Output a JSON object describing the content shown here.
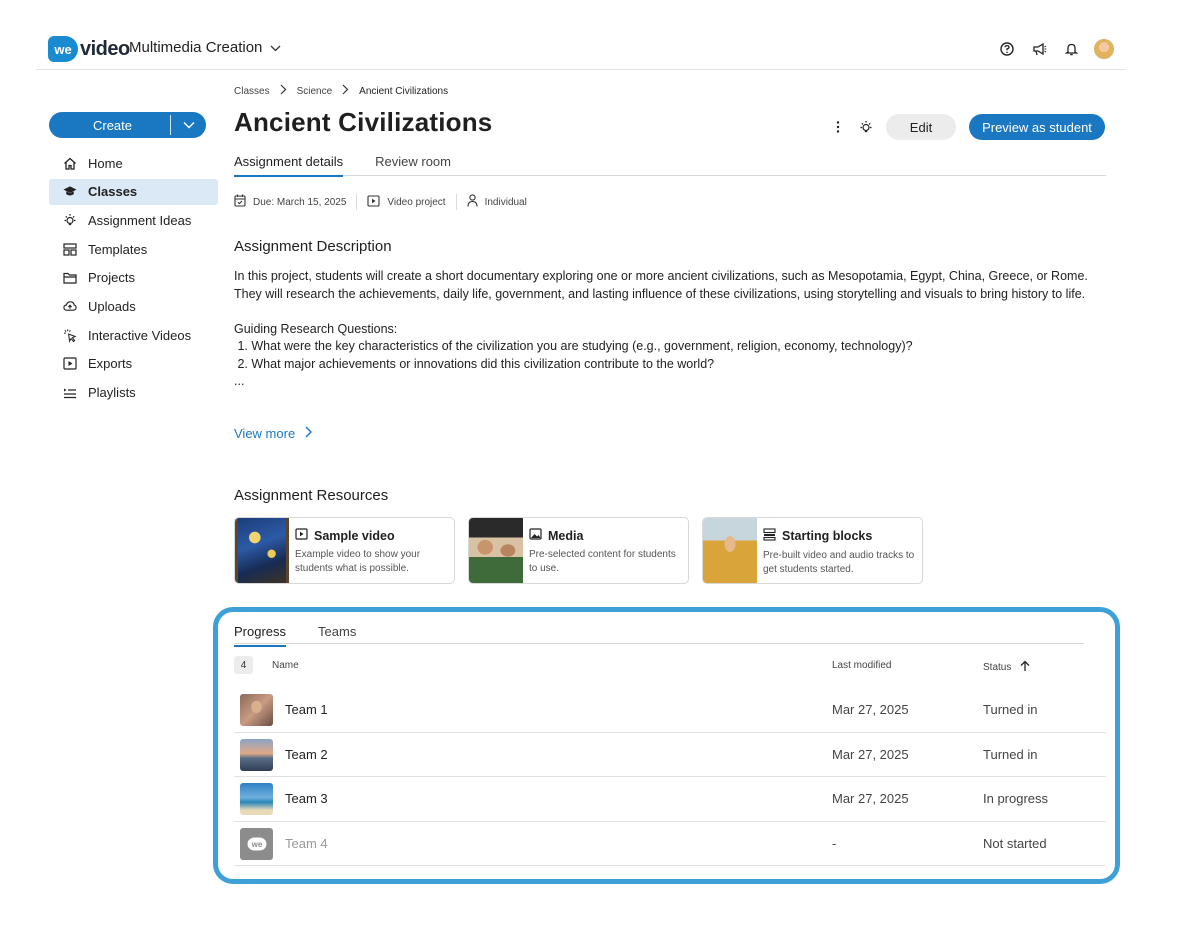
{
  "app": {
    "logo_badge": "we",
    "logo_text": "video",
    "workspace_name": "Multimedia Creation",
    "brand_color": "#1a78c2"
  },
  "top_icons": [
    "help-icon",
    "announcement-icon",
    "bell-icon",
    "user-avatar"
  ],
  "sidebar": {
    "create_label": "Create",
    "items": [
      {
        "label": "Home",
        "icon": "home-icon",
        "active": false
      },
      {
        "label": "Classes",
        "icon": "graduation-cap-icon",
        "active": true
      },
      {
        "label": "Assignment Ideas",
        "icon": "lightbulb-icon",
        "active": false
      },
      {
        "label": "Templates",
        "icon": "templates-icon",
        "active": false
      },
      {
        "label": "Projects",
        "icon": "folder-icon",
        "active": false
      },
      {
        "label": "Uploads",
        "icon": "upload-cloud-icon",
        "active": false
      },
      {
        "label": "Interactive Videos",
        "icon": "click-icon",
        "active": false
      },
      {
        "label": "Exports",
        "icon": "play-square-icon",
        "active": false
      },
      {
        "label": "Playlists",
        "icon": "playlist-icon",
        "active": false
      }
    ]
  },
  "breadcrumb": [
    "Classes",
    "Science",
    "Ancient Civilizations"
  ],
  "page": {
    "title": "Ancient Civilizations",
    "edit_label": "Edit",
    "preview_label": "Preview as student",
    "tabs": [
      "Assignment details",
      "Review room"
    ],
    "meta": {
      "due": "Due: March 15, 2025",
      "type": "Video project",
      "mode": "Individual"
    }
  },
  "description": {
    "heading": "Assignment Description",
    "paragraph": "In this project, students will create a short documentary exploring one or more ancient civilizations, such as Mesopotamia, Egypt, China, Greece, or Rome. They will research the achievements, daily life, government, and lasting influence of these civilizations, using storytelling and visuals to bring history to life.",
    "questions_heading": "Guiding Research Questions:",
    "q1": " 1. What were the key characteristics of the civilization you are studying (e.g., government, religion, economy, technology)?",
    "q2": " 2. What major achievements or innovations did this civilization contribute to the world?",
    "ellipsis": "...",
    "view_more": "View more"
  },
  "resources": {
    "heading": "Assignment Resources",
    "cards": [
      {
        "title": "Sample video",
        "icon": "play-square-icon",
        "desc": "Example video to show your students what is possible."
      },
      {
        "title": "Media",
        "icon": "image-icon",
        "desc": "Pre-selected content for students to use."
      },
      {
        "title": "Starting blocks",
        "icon": "blocks-icon",
        "desc": "Pre-built video and audio tracks to get students started."
      }
    ]
  },
  "progress": {
    "tabs": [
      "Progress",
      "Teams"
    ],
    "count": "4",
    "columns": {
      "name": "Name",
      "modified": "Last modified",
      "status": "Status"
    },
    "highlight_color": "#3fa0d8",
    "rows": [
      {
        "name": "Team 1",
        "modified": "Mar 27, 2025",
        "status": "Turned in"
      },
      {
        "name": "Team 2",
        "modified": "Mar 27, 2025",
        "status": "Turned in"
      },
      {
        "name": "Team 3",
        "modified": "Mar 27, 2025",
        "status": "In progress"
      },
      {
        "name": "Team 4",
        "modified": "-",
        "status": "Not started"
      }
    ]
  }
}
